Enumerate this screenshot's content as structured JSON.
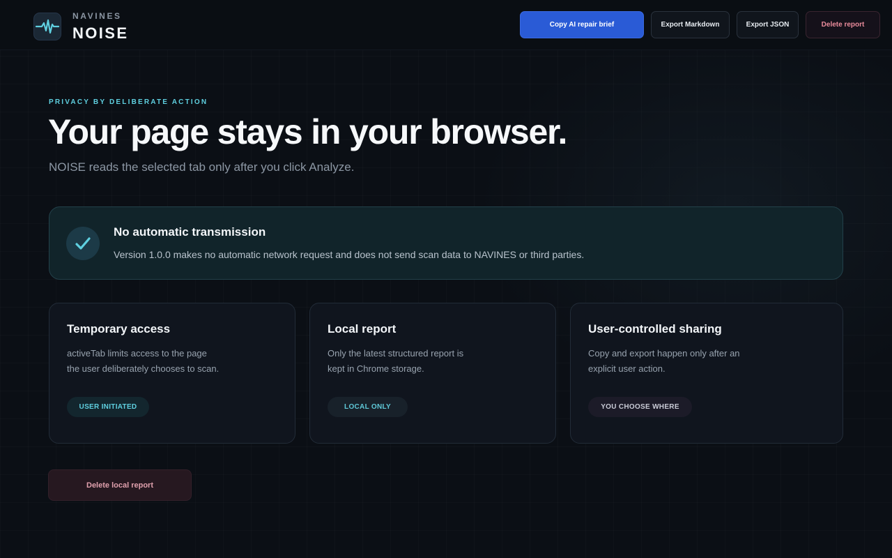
{
  "brand": {
    "company": "NAVINES",
    "product": "NOISE",
    "logo_icon": "waveform-icon"
  },
  "toolbar": {
    "copy_brief_label": "Copy AI repair brief",
    "export_markdown_label": "Export Markdown",
    "export_json_label": "Export JSON",
    "delete_report_label": "Delete report"
  },
  "hero": {
    "eyebrow": "PRIVACY BY DELIBERATE ACTION",
    "title": "Your page stays in your browser.",
    "subtitle": "NOISE reads the selected tab only after you click Analyze."
  },
  "notice": {
    "icon": "checkmark-icon",
    "title": "No automatic transmission",
    "body": "Version 1.0.0 makes no automatic network request and does not send scan data to NAVINES or third parties."
  },
  "cards": [
    {
      "title": "Temporary access",
      "line1": "activeTab limits access to the page",
      "line2": "the user deliberately chooses to scan.",
      "badge": "USER INITIATED"
    },
    {
      "title": "Local report",
      "line1": "Only the latest structured report is",
      "line2": "kept in Chrome storage.",
      "badge": "LOCAL ONLY"
    },
    {
      "title": "User-controlled sharing",
      "line1": "Copy and export happen only after an",
      "line2": "explicit user action.",
      "badge": "YOU CHOOSE WHERE"
    }
  ],
  "footer": {
    "delete_local_label": "Delete local report"
  },
  "colors": {
    "accent": "#5fd0e0",
    "primary_button": "#2a5bd6",
    "danger_text": "#e98b9b",
    "background": "#0b0f15"
  }
}
